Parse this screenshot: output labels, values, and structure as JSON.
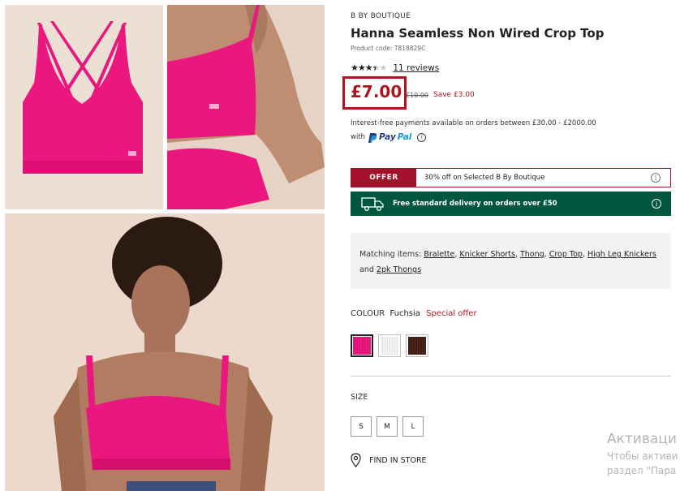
{
  "product": {
    "brand": "B BY BOUTIQUE",
    "title": "Hanna Seamless Non Wired Crop Top",
    "code": "Product code: T818829C",
    "rating": 3.5,
    "reviews": "11 reviews",
    "price": "£7.00",
    "was_price": "£10.00",
    "save": "Save £3.00",
    "payment_text": "Interest-free payments available on orders between £30.00 - £2000.00",
    "payment_with": "with",
    "paypal_p1": "Pay",
    "paypal_p2": "Pal",
    "info_glyph": "i"
  },
  "offer": {
    "tag": "OFFER",
    "text": "30% off on Selected B By Boutique",
    "info_glyph": "i"
  },
  "delivery": {
    "text": "Free standard delivery on orders over £50",
    "info_glyph": "i"
  },
  "matching": {
    "label": "Matching items:",
    "items": [
      "Bralette",
      "Knicker Shorts",
      "Thong",
      "Crop Top",
      "High Leg Knickers",
      "2pk Thongs"
    ],
    "sep": ", ",
    "and": " and "
  },
  "colour": {
    "label": "COLOUR",
    "value": "Fuchsia",
    "special": "Special offer",
    "swatches": [
      "Fuchsia",
      "White",
      "Brown"
    ]
  },
  "size": {
    "label": "SIZE",
    "options": [
      "S",
      "M",
      "L"
    ]
  },
  "store": {
    "label": "FIND IN STORE"
  },
  "watermark": {
    "line1": "Активаци",
    "line2": "Чтобы активи",
    "line3": "раздел \"Пара"
  },
  "colors": {
    "accent_red": "#b0151e",
    "offer_red": "#a3122c",
    "delivery_green": "#00563f",
    "product_pink": "#e9177e"
  }
}
